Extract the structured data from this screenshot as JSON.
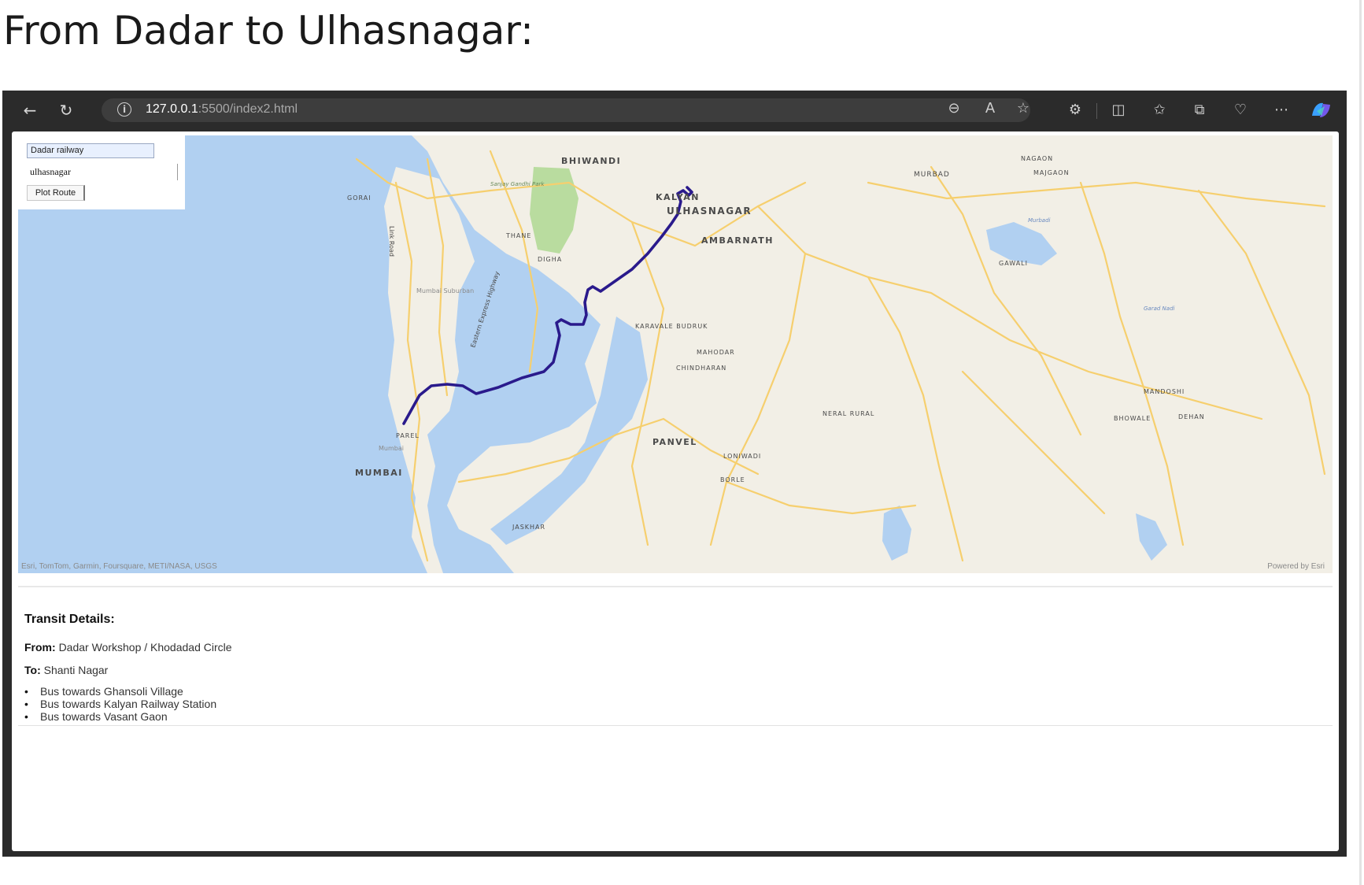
{
  "caption": "From Dadar to Ulhasnagar:",
  "browser": {
    "url_host": "127.0.0.1",
    "url_path": ":5500/index2.html",
    "icons": [
      "back-icon",
      "refresh-icon",
      "site-info-icon",
      "zoom-out-icon",
      "read-aloud-icon",
      "favorite-icon",
      "extensions-icon",
      "split-screen-icon",
      "favorites-icon",
      "collections-icon",
      "browser-essentials-icon",
      "more-icon",
      "copilot-icon"
    ]
  },
  "form": {
    "origin_value": "Dadar railway",
    "destination_value": "ulhasnagar",
    "plot_button_label": "Plot Route"
  },
  "map": {
    "labels": {
      "bhiwandi": "BHIWANDI",
      "kalyan": "KALYAN",
      "ulhasnagar": "ULHASNAGAR",
      "ambarnath": "AMBARNATH",
      "murbad": "MURBAD",
      "nagaon": "NAGAON",
      "majgaon": "MAJGAON",
      "gawali": "GAWALI",
      "gorai": "GORAI",
      "thane": "THANE",
      "digha": "DIGHA",
      "sgnp": "Sanjay Gandhi Park",
      "link_road": "Link Road",
      "mumbai_suburban": "Mumbai Suburban",
      "eeh": "Eastern Express Highway",
      "karavale": "KARAVALE BUDRUK",
      "mahodar": "MAHODAR",
      "chindharan": "CHINDHARAN",
      "neral": "NERAL RURAL",
      "panvel": "PANVEL",
      "loniwadi": "LONIWADI",
      "borle": "BORLE",
      "parel": "PAREL",
      "mumbai_small": "Mumbai",
      "mumbai": "MUMBAI",
      "mandoshi": "MANDOSHI",
      "bhowale": "BHOWALE",
      "dehan": "DEHAN",
      "ganesh_nadi": "Garad Nadi",
      "murbadi": "Murbadi",
      "jaskhar": "JASKHAR"
    },
    "attribution": "Esri, TomTom, Garmin, Foursquare, METI/NASA, USGS",
    "powered_by": "Powered by Esri",
    "route_color": "#2a1a8c",
    "water_color": "#b1d0f1",
    "land_color": "#f2efe6",
    "road_color": "#f6cf6e"
  },
  "transit": {
    "heading": "Transit Details:",
    "from_label": "From:",
    "from_value": "Dadar Workshop / Khodadad Circle",
    "to_label": "To:",
    "to_value": "Shanti Nagar",
    "steps": [
      "Bus towards Ghansoli Village",
      "Bus towards Kalyan Railway Station",
      "Bus towards Vasant Gaon"
    ]
  }
}
